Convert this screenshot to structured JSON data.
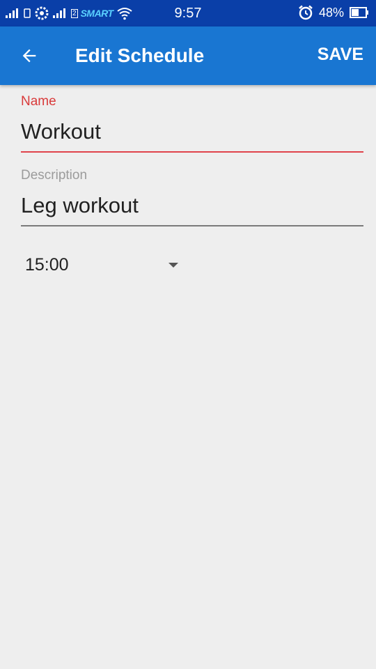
{
  "status_bar": {
    "time": "9:57",
    "battery": "48%",
    "carrier": "SMART",
    "sim_number": "2",
    "icons": [
      "signal-icon",
      "sim-icon",
      "settings-gear-icon",
      "signal-icon",
      "wifi-icon",
      "alarm-icon",
      "battery-icon"
    ]
  },
  "app_bar": {
    "title": "Edit Schedule",
    "save_label": "SAVE",
    "back_icon": "arrow-back-icon",
    "color": "#1976d2"
  },
  "form": {
    "name": {
      "label": "Name",
      "value": "Workout",
      "accent": "#e0434b"
    },
    "description": {
      "label": "Description",
      "value": "Leg workout"
    },
    "time": {
      "selected": "15:00"
    }
  }
}
